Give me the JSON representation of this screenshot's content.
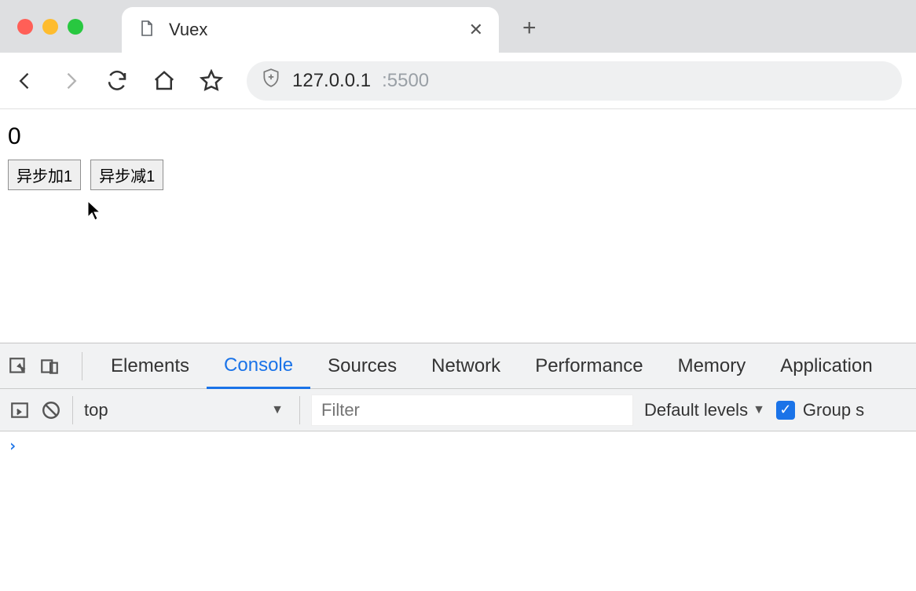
{
  "browser": {
    "tab_title": "Vuex",
    "url_host": "127.0.0.1",
    "url_port": ":5500"
  },
  "page": {
    "counter_value": "0",
    "btn_async_add": "异步加1",
    "btn_async_sub": "异步减1"
  },
  "devtools": {
    "tabs": {
      "elements": "Elements",
      "console": "Console",
      "sources": "Sources",
      "network": "Network",
      "performance": "Performance",
      "memory": "Memory",
      "application": "Application"
    },
    "console": {
      "context": "top",
      "filter_placeholder": "Filter",
      "levels_label": "Default levels",
      "group_label": "Group s",
      "prompt": "›"
    }
  }
}
